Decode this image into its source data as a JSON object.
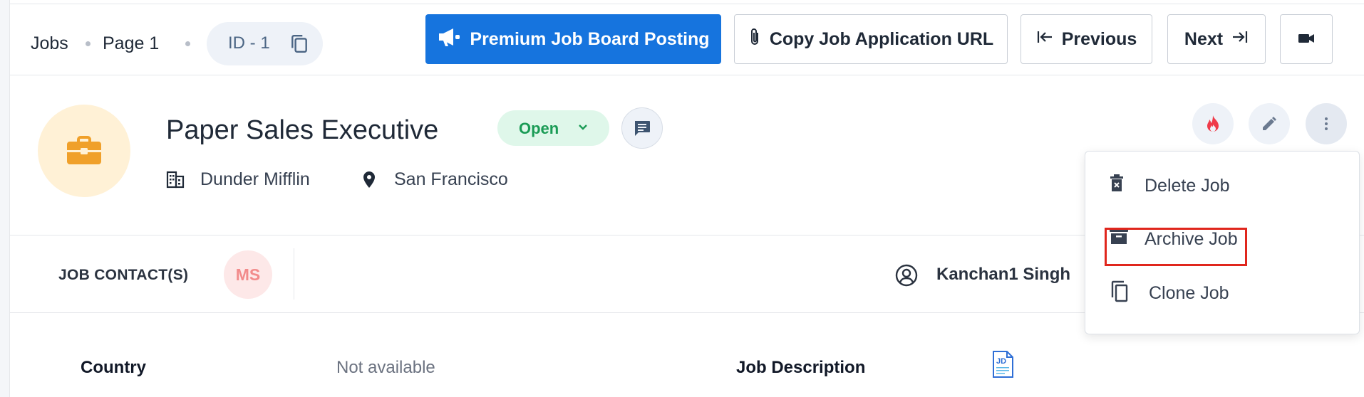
{
  "breadcrumb": {
    "jobs": "Jobs",
    "page": "Page 1",
    "id": "ID - 1"
  },
  "toolbar": {
    "premium_label": "Premium Job Board Posting",
    "copy_url_label": "Copy Job Application URL",
    "previous_label": "Previous",
    "next_label": "Next"
  },
  "job": {
    "title": "Paper Sales Executive",
    "status": "Open",
    "company": "Dunder Mifflin",
    "location": "San Francisco"
  },
  "contacts": {
    "label": "JOB CONTACT(S)",
    "initials": "MS",
    "owner": "Kanchan1 Singh"
  },
  "details": {
    "country_label": "Country",
    "country_value": "Not available",
    "description_label": "Job Description",
    "jd_badge": "JD"
  },
  "menu": {
    "items": [
      {
        "label": "Delete Job",
        "icon": "delete-icon"
      },
      {
        "label": "Archive Job",
        "icon": "archive-icon"
      },
      {
        "label": "Clone Job",
        "icon": "clone-icon"
      }
    ]
  },
  "colors": {
    "primary": "#1674de",
    "status_green": "#1a9b55",
    "highlight_red": "#e0261d",
    "logo_orange": "#f0a02a"
  }
}
